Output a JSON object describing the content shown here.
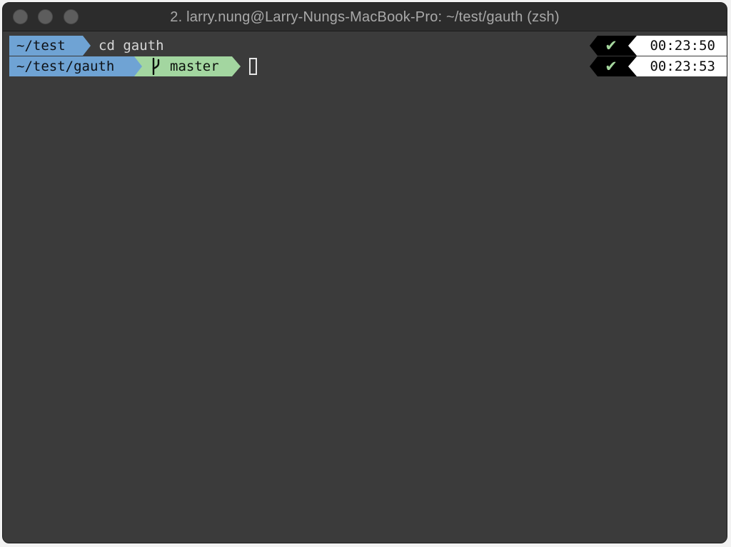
{
  "window": {
    "title": "2. larry.nung@Larry-Nungs-MacBook-Pro: ~/test/gauth (zsh)"
  },
  "terminal": {
    "lines": [
      {
        "dir": "~/test",
        "command": "cd gauth",
        "status_icon": "check-icon",
        "time": "00:23:50"
      },
      {
        "dir": "~/test/gauth",
        "git_branch": "master",
        "branch_icon": "git-branch-icon",
        "status_icon": "check-icon",
        "time": "00:23:53"
      }
    ],
    "check_glyph": "✔"
  },
  "colors": {
    "dir_segment": "#6fa3d4",
    "git_segment": "#a3d6a0",
    "time_segment": "#ffffff",
    "status_segment": "#000000",
    "check": "#a5d79e",
    "background": "#3b3b3b"
  }
}
